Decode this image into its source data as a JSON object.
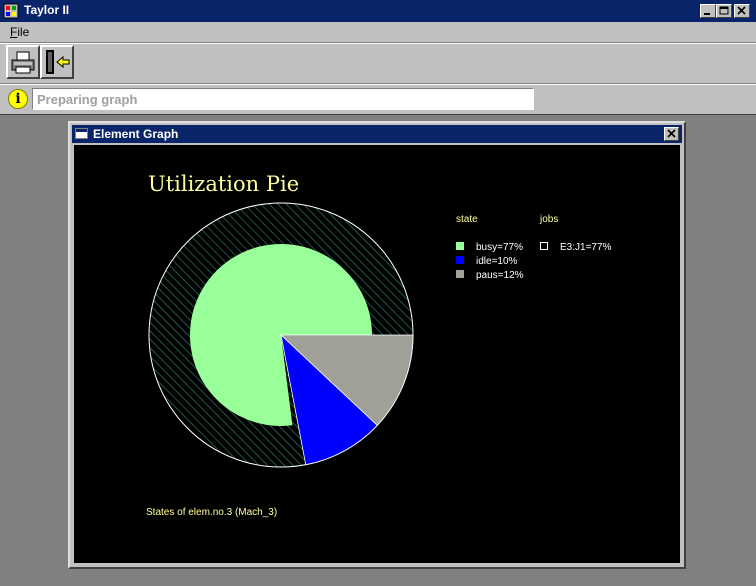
{
  "window": {
    "title": "Taylor II"
  },
  "menu": {
    "file_label_first": "F",
    "file_label_rest": "ile"
  },
  "toolbar": {
    "buttons": [
      {
        "icon": "printer-icon"
      },
      {
        "icon": "exit-door-icon"
      }
    ]
  },
  "status": {
    "icon": "info-icon",
    "info_glyph": "i",
    "text": "Preparing graph"
  },
  "child_window": {
    "title": "Element Graph"
  },
  "graph": {
    "title": "Utilization Pie",
    "caption": "States of elem.no.3 (Mach_3)",
    "legend": {
      "state_header": "state",
      "jobs_header": "jobs",
      "state_items": [
        "busy=77%",
        "idle=10%",
        "paus=12%"
      ],
      "jobs_items": [
        "E3:J1=77%"
      ]
    },
    "colors": {
      "busy": "#99ff99",
      "idle": "#0000ff",
      "paus": "#a0a098",
      "title": "#ffff99",
      "label": "#ffff99",
      "text": "#ffffff",
      "hatch": "#2e8b7a"
    }
  },
  "chart_data": {
    "type": "pie",
    "title": "Utilization Pie",
    "inner_series": {
      "name": "state",
      "categories": [
        "busy",
        "idle",
        "paus"
      ],
      "values": [
        77,
        10,
        12
      ]
    },
    "outer_series": {
      "name": "jobs",
      "categories": [
        "E3:J1"
      ],
      "values": [
        77
      ]
    },
    "legend": "right"
  }
}
